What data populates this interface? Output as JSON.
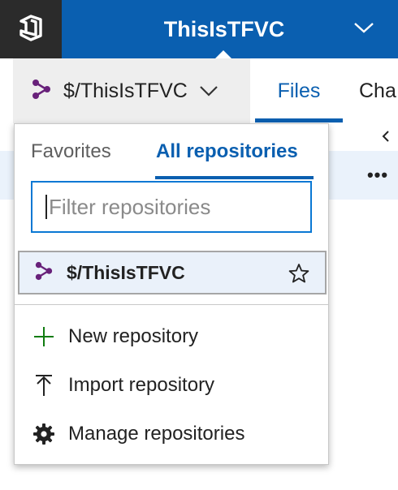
{
  "header": {
    "project_title": "ThisIsTFVC",
    "logo_icon": "azure-devops-logo-icon",
    "project_dropdown_icon": "chevron-down-icon",
    "background_color": "#0a5fb0",
    "logo_background_color": "#2b2b2b"
  },
  "subnav": {
    "repo_picker_label": "$/ThisIsTFVC",
    "repo_icon": "repo-branch-icon",
    "repo_icon_color": "#68217a",
    "picker_chevron_icon": "chevron-down-icon",
    "tabs": [
      {
        "label": "Files",
        "selected": true
      },
      {
        "label": "Cha",
        "selected": false
      }
    ],
    "accent_color": "#0a5fb0"
  },
  "background": {
    "collapse_icon": "chevron-left-icon",
    "more_actions_label": "•••"
  },
  "dropdown": {
    "tabs": [
      {
        "label": "Favorites",
        "selected": false
      },
      {
        "label": "All repositories",
        "selected": true
      }
    ],
    "filter": {
      "placeholder": "Filter repositories",
      "value": ""
    },
    "repositories": [
      {
        "name": "$/ThisIsTFVC",
        "icon": "repo-branch-icon",
        "favorite_icon": "star-outline-icon",
        "selected": true
      }
    ],
    "actions": [
      {
        "label": "New repository",
        "icon": "plus-icon",
        "icon_color": "#107c10"
      },
      {
        "label": "Import repository",
        "icon": "import-arrow-icon"
      },
      {
        "label": "Manage repositories",
        "icon": "gear-icon"
      }
    ]
  }
}
